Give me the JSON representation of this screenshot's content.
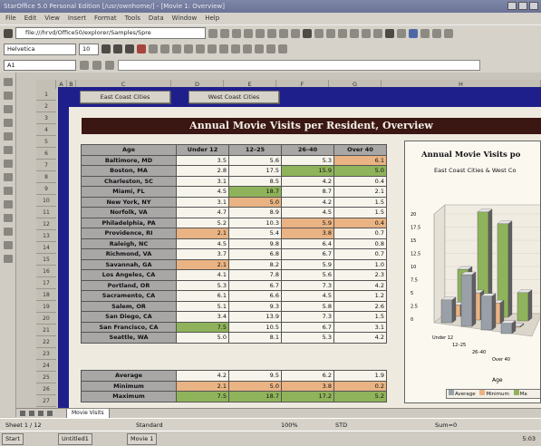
{
  "window": {
    "title": "StarOffice 5.0 Personal Edition [/usr/ownhome/] - [Movie 1: Overview]"
  },
  "menu": {
    "items": [
      "File",
      "Edit",
      "View",
      "Insert",
      "Format",
      "Tools",
      "Data",
      "Window",
      "Help"
    ]
  },
  "url": {
    "value": "file:///hrvd/Office50/explorer/Samples/Spre"
  },
  "format": {
    "font": "Helvetica",
    "size": "10"
  },
  "namebox": {
    "value": "A1"
  },
  "columns": [
    "A",
    "B",
    "C",
    "D",
    "E",
    "F",
    "G",
    "H"
  ],
  "rows": [
    "1",
    "2",
    "3",
    "4",
    "5",
    "6",
    "7",
    "8",
    "9",
    "10",
    "11",
    "12",
    "13",
    "14",
    "15",
    "16",
    "17",
    "18",
    "19",
    "20",
    "21",
    "22",
    "23",
    "24",
    "25",
    "26",
    "27"
  ],
  "nav": {
    "east": "East Coast Cities",
    "west": "West Coast Cities"
  },
  "banner": "Annual Movie Visits per Resident, Overview",
  "table": {
    "headers": [
      "Age",
      "Under 12",
      "12–25",
      "26–40",
      "Over 40"
    ],
    "rows": [
      {
        "city": "Baltimore, MD",
        "v": [
          "3.5",
          "5.6",
          "5.3",
          "6.1"
        ],
        "hl": [
          "",
          "",
          "",
          "lo"
        ]
      },
      {
        "city": "Boston, MA",
        "v": [
          "2.8",
          "17.5",
          "15.9",
          "5.0"
        ],
        "hl": [
          "",
          "",
          "hi",
          "hi"
        ]
      },
      {
        "city": "Charleston, SC",
        "v": [
          "3.1",
          "8.5",
          "4.2",
          "0.4"
        ],
        "hl": [
          "",
          "",
          "",
          ""
        ]
      },
      {
        "city": "Miami, FL",
        "v": [
          "4.5",
          "18.7",
          "8.7",
          "2.1"
        ],
        "hl": [
          "",
          "hi",
          "",
          ""
        ]
      },
      {
        "city": "New York, NY",
        "v": [
          "3.1",
          "5.0",
          "4.2",
          "1.5"
        ],
        "hl": [
          "",
          "lo",
          "",
          ""
        ]
      },
      {
        "city": "Norfolk, VA",
        "v": [
          "4.7",
          "8.9",
          "4.5",
          "1.5"
        ],
        "hl": [
          "",
          "",
          "",
          ""
        ]
      },
      {
        "city": "Philadelphia, PA",
        "v": [
          "5.2",
          "10.3",
          "5.9",
          "0.4"
        ],
        "hl": [
          "",
          "",
          "lo",
          "lo"
        ]
      },
      {
        "city": "Providence, RI",
        "v": [
          "2.1",
          "5.4",
          "3.8",
          "0.7"
        ],
        "hl": [
          "lo",
          "",
          "lo",
          ""
        ]
      },
      {
        "city": "Raleigh, NC",
        "v": [
          "4.5",
          "9.8",
          "6.4",
          "0.8"
        ],
        "hl": [
          "",
          "",
          "",
          ""
        ]
      },
      {
        "city": "Richmond, VA",
        "v": [
          "3.7",
          "6.8",
          "6.7",
          "0.7"
        ],
        "hl": [
          "",
          "",
          "",
          ""
        ]
      },
      {
        "city": "Savannah, GA",
        "v": [
          "2.1",
          "8.2",
          "5.9",
          "1.0"
        ],
        "hl": [
          "lo",
          "",
          "",
          ""
        ]
      },
      {
        "city": "Los Angeles, CA",
        "v": [
          "4.1",
          "7.8",
          "5.6",
          "2.3"
        ],
        "hl": [
          "",
          "",
          "",
          ""
        ]
      },
      {
        "city": "Portland, OR",
        "v": [
          "5.3",
          "6.7",
          "7.3",
          "4.2"
        ],
        "hl": [
          "",
          "",
          "",
          ""
        ]
      },
      {
        "city": "Sacramento, CA",
        "v": [
          "6.1",
          "6.6",
          "4.5",
          "1.2"
        ],
        "hl": [
          "",
          "",
          "",
          ""
        ]
      },
      {
        "city": "Salem, OR",
        "v": [
          "5.1",
          "9.3",
          "5.8",
          "2.6"
        ],
        "hl": [
          "",
          "",
          "",
          ""
        ]
      },
      {
        "city": "San Diego, CA",
        "v": [
          "3.4",
          "13.9",
          "7.3",
          "1.5"
        ],
        "hl": [
          "",
          "",
          "",
          ""
        ]
      },
      {
        "city": "San Francisco, CA",
        "v": [
          "7.5",
          "10.5",
          "6.7",
          "3.1"
        ],
        "hl": [
          "hi",
          "",
          "",
          ""
        ]
      },
      {
        "city": "Seattle, WA",
        "v": [
          "5.0",
          "8.1",
          "5.3",
          "4.2"
        ],
        "hl": [
          "",
          "",
          "",
          ""
        ]
      }
    ]
  },
  "stats": [
    {
      "label": "Average",
      "v": [
        "4.2",
        "9.5",
        "6.2",
        "1.9"
      ],
      "hl": [
        "",
        "",
        "",
        ""
      ]
    },
    {
      "label": "Minimum",
      "v": [
        "2.1",
        "5.0",
        "3.8",
        "0.2"
      ],
      "hl": [
        "lo",
        "lo",
        "lo",
        "lo"
      ]
    },
    {
      "label": "Maximum",
      "v": [
        "7.5",
        "18.7",
        "17.2",
        "5.2"
      ],
      "hl": [
        "hi",
        "hi",
        "hi",
        "hi"
      ]
    }
  ],
  "chart": {
    "title": "Annual Movie Visits po",
    "subtitle": "East Coast Cities & West Co",
    "yticks": [
      "20",
      "17.5",
      "15",
      "12.5",
      "10",
      "7.5",
      "5",
      "2.5",
      "0"
    ],
    "xlabel": "Age",
    "xcats": [
      "Under 12",
      "12–25",
      "26–40",
      "Over 40"
    ],
    "legend": [
      "Average",
      "Minimum",
      "Ma"
    ]
  },
  "colors": {
    "high": "#8fb35a",
    "low": "#e9b383",
    "banner": "#3a1712",
    "frame": "#1f1f8c"
  },
  "sheet_tab": "Movie Visits",
  "status": {
    "sheet": "Sheet 1 / 12",
    "style": "Standard",
    "zoom": "100%",
    "mode": "STD",
    "sum": "Sum=0"
  },
  "taskbar": {
    "start": "Start",
    "task1": "Untitled1",
    "task2": "Movie 1",
    "clock": "5:03"
  }
}
